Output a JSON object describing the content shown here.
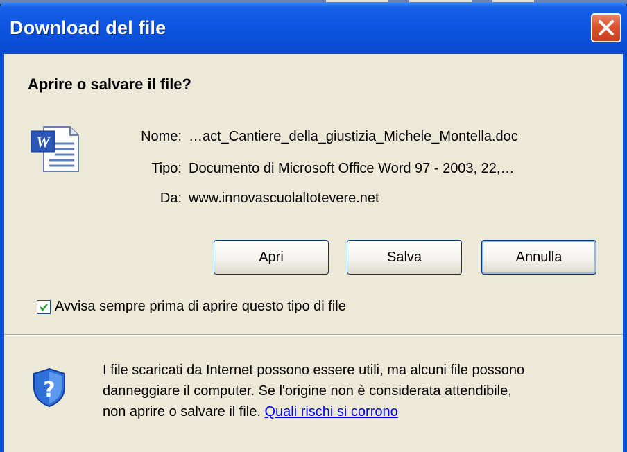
{
  "window": {
    "title": "Download del file",
    "close_icon": "close-icon"
  },
  "dialog": {
    "heading": "Aprire o salvare il file?",
    "file_icon": "word-document-icon",
    "fields": [
      {
        "label": "Nome:",
        "value": "…act_Cantiere_della_giustizia_Michele_Montella.doc"
      },
      {
        "label": "Tipo:",
        "value": "Documento di Microsoft Office Word 97 - 2003, 22,…"
      },
      {
        "label": "Da:",
        "value": "www.innovascuolaltotevere.net"
      }
    ],
    "buttons": {
      "open": "Apri",
      "save": "Salva",
      "cancel": "Annulla"
    },
    "checkbox": {
      "label": "Avvisa sempre prima di aprire questo tipo di file",
      "checked": true
    },
    "warning": {
      "icon": "security-shield-question-icon",
      "line1": "I file scaricati da Internet possono essere utili, ma alcuni file possono",
      "line2": "danneggiare il computer. Se l'origine non è considerata attendibile,",
      "line3": "non aprire o salvare il file.",
      "link": "Quali rischi si corrono"
    }
  },
  "colors": {
    "titlebar": "#0b4ed6",
    "client_bg": "#ece9d8",
    "close_button": "#d9542e",
    "link": "#0000ff"
  }
}
